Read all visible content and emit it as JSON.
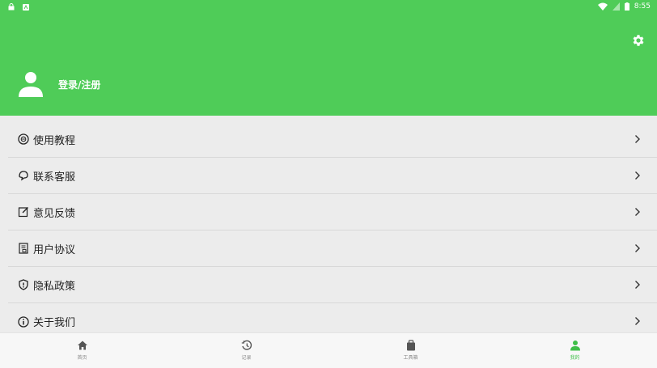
{
  "status_bar": {
    "time": "8:55"
  },
  "header": {
    "login_label": "登录/注册"
  },
  "menu": {
    "items": [
      {
        "label": "使用教程",
        "icon": "tutorial-icon"
      },
      {
        "label": "联系客服",
        "icon": "customer-service-icon"
      },
      {
        "label": "意见反馈",
        "icon": "feedback-icon"
      },
      {
        "label": "用户协议",
        "icon": "agreement-icon"
      },
      {
        "label": "隐私政策",
        "icon": "privacy-shield-icon"
      },
      {
        "label": "关于我们",
        "icon": "info-icon"
      }
    ]
  },
  "bottom_nav": {
    "items": [
      {
        "label": "首页",
        "icon": "home-icon"
      },
      {
        "label": "记录",
        "icon": "history-icon"
      },
      {
        "label": "工具箱",
        "icon": "toolbox-icon"
      },
      {
        "label": "我的",
        "icon": "person-icon",
        "active": true
      }
    ]
  },
  "colors": {
    "primary": "#4fcc58",
    "active_nav": "#3fbf48",
    "background": "#ececec"
  }
}
